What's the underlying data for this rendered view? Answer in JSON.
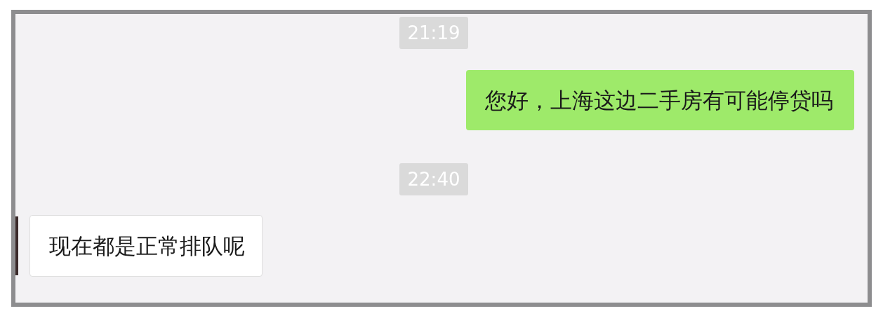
{
  "messages": [
    {
      "kind": "time",
      "text": "21:19"
    },
    {
      "kind": "sent",
      "text": "您好，上海这边二手房有可能停贷吗"
    },
    {
      "kind": "time",
      "text": "22:40"
    },
    {
      "kind": "received",
      "text": "现在都是正常排队呢"
    }
  ]
}
